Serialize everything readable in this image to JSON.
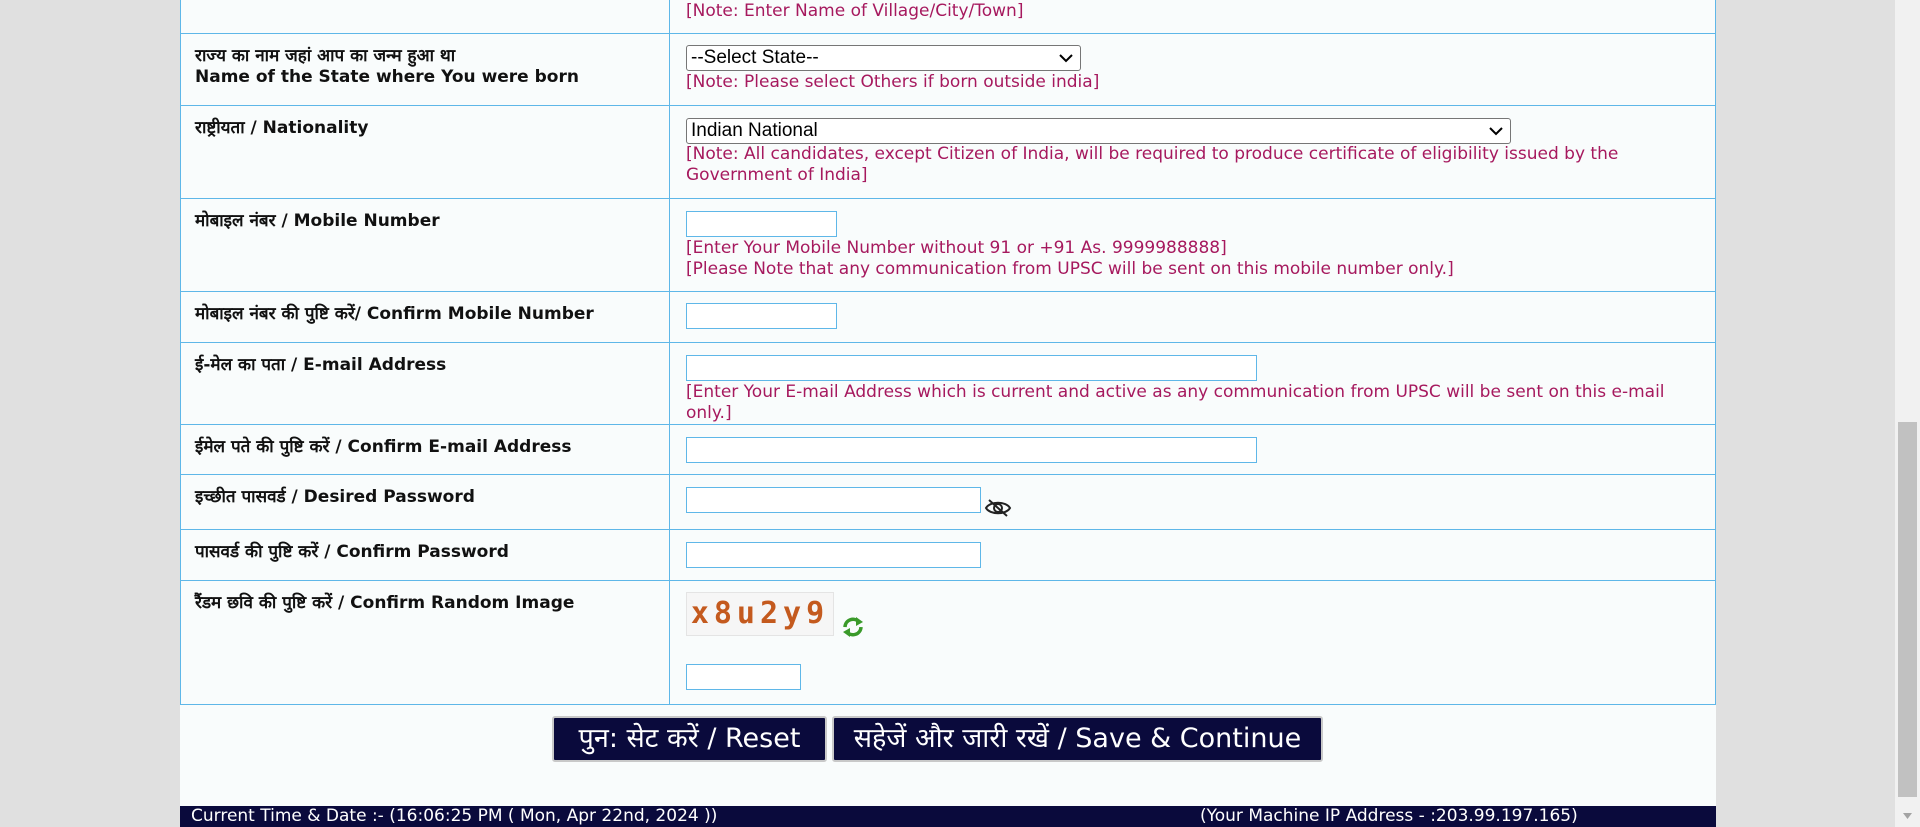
{
  "rows": {
    "birthplace_note": "[Note: Enter Name of Village/City/Town]",
    "state": {
      "label_hi": "राज्य का नाम जहां आप का जन्म हुआ था",
      "label_en": "Name of the State where You were born",
      "selected": "--Select State--",
      "note": "[Note: Please select Others if born outside india]"
    },
    "nationality": {
      "label": "राष्ट्रीयता / Nationality",
      "selected": "Indian National",
      "note": "[Note: All candidates, except Citizen of India, will be required to produce certificate of eligibility issued by the Government of India]"
    },
    "mobile": {
      "label": "मोबाइल नंबर / Mobile Number",
      "value": "",
      "note1": "[Enter Your Mobile Number without 91 or +91 As. 9999988888]",
      "note2": "[Please Note that any communication from UPSC will be sent on this mobile number only.]"
    },
    "confirm_mobile": {
      "label": "मोबाइल नंबर की पुष्टि करें/ Confirm Mobile Number",
      "value": ""
    },
    "email": {
      "label": "ई-मेल का पता / E-mail Address",
      "value": "",
      "note": "[Enter Your E-mail Address which is current and active as any communication from UPSC will be sent on this e-mail only.]"
    },
    "confirm_email": {
      "label": "ईमेल पते की पुष्टि करें / Confirm E-mail Address",
      "value": ""
    },
    "password": {
      "label": "इच्छीत पासवर्ड / Desired Password",
      "value": ""
    },
    "confirm_password": {
      "label": "पासवर्ड की पुष्टि करें / Confirm Password",
      "value": ""
    },
    "captcha": {
      "label": "रैंडम छवि की पुष्टि करें / Confirm Random Image",
      "image_text": "x8u2y9",
      "value": ""
    }
  },
  "buttons": {
    "reset": "पुन: सेट करें / Reset",
    "save": "सहेजें और जारी रखें / Save & Continue"
  },
  "footer": {
    "time": "Current Time & Date :- (16:06:25 PM ( Mon, Apr 22nd, 2024 ))",
    "ip": "(Your Machine IP  Address - :203.99.197.165)"
  },
  "colors": {
    "note": "#a6195e",
    "border": "#5fb7e8",
    "button_bg": "#0a0a3c",
    "footer_bg": "#0a0a3c"
  },
  "icons": {
    "dropdown": "chevron-down-icon",
    "show_password": "eye-slash-icon",
    "refresh_captcha": "refresh-icon"
  }
}
